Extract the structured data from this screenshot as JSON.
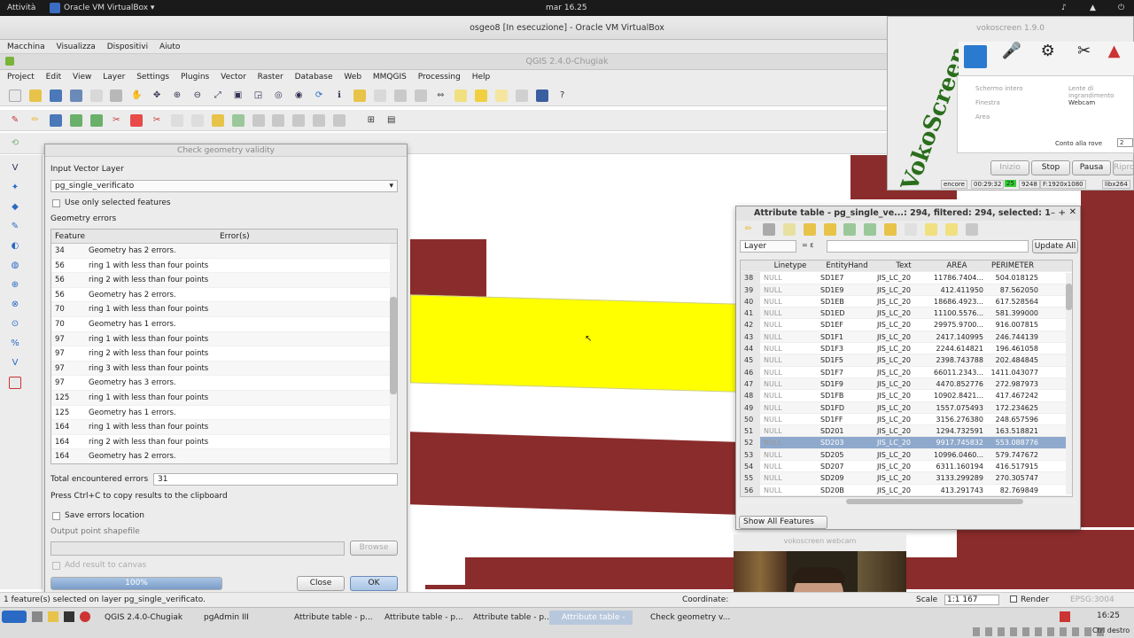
{
  "topbar": {
    "activities": "Attività",
    "vbox_app": "Oracle VM VirtualBox ▾",
    "clock": "mar 16.25"
  },
  "vbox": {
    "title": "osgeo8 [In esecuzione] - Oracle VM VirtualBox",
    "menu": [
      "Macchina",
      "Visualizza",
      "Dispositivi",
      "Aiuto"
    ]
  },
  "qgis": {
    "title": "QGIS 2.4.0-Chugiak",
    "menu": [
      "Project",
      "Edit",
      "View",
      "Layer",
      "Settings",
      "Plugins",
      "Vector",
      "Raster",
      "Database",
      "Web",
      "MMQGIS",
      "Processing",
      "Help"
    ]
  },
  "check_dialog": {
    "title": "Check geometry validity",
    "input_label": "Input Vector Layer",
    "input_value": "pg_single_verificato",
    "use_selected": "Use only selected features",
    "errors_label": "Geometry errors",
    "col_feature": "Feature",
    "col_error": "Error(s)",
    "rows": [
      {
        "f": "34",
        "e": "Geometry has 2 errors."
      },
      {
        "f": "56",
        "e": "ring 1 with less than four points"
      },
      {
        "f": "56",
        "e": "ring 2 with less than four points"
      },
      {
        "f": "56",
        "e": "Geometry has 2 errors."
      },
      {
        "f": "70",
        "e": "ring 1 with less than four points"
      },
      {
        "f": "70",
        "e": "Geometry has 1 errors."
      },
      {
        "f": "97",
        "e": "ring 1 with less than four points"
      },
      {
        "f": "97",
        "e": "ring 2 with less than four points"
      },
      {
        "f": "97",
        "e": "ring 3 with less than four points"
      },
      {
        "f": "97",
        "e": "Geometry has 3 errors."
      },
      {
        "f": "125",
        "e": "ring 1 with less than four points"
      },
      {
        "f": "125",
        "e": "Geometry has 1 errors."
      },
      {
        "f": "164",
        "e": "ring 1 with less than four points"
      },
      {
        "f": "164",
        "e": "ring 2 with less than four points"
      },
      {
        "f": "164",
        "e": "Geometry has 2 errors."
      }
    ],
    "total_label": "Total encountered errors",
    "total_value": "31",
    "copy_hint": "Press Ctrl+C to copy results to the clipboard",
    "save_errors": "Save errors location",
    "output_label": "Output point shapefile",
    "browse": "Browse",
    "add_result": "Add result to canvas",
    "progress_text": "100%",
    "progress": 1.0,
    "close": "Close",
    "ok": "OK"
  },
  "attr_table": {
    "title": "Attribute table - pg_single_ve...: 294, filtered: 294, selected: 1",
    "layer_combo": "Layer",
    "update_all": "Update All",
    "columns": [
      "Linetype",
      "EntityHand",
      "Text",
      "AREA",
      "PERIMETER"
    ],
    "rows": [
      {
        "n": "38",
        "a": "NULL",
        "b": "SD1E7",
        "c": "JIS_LC_20",
        "d": "11786.7404...",
        "e": "504.018125"
      },
      {
        "n": "39",
        "a": "NULL",
        "b": "SD1E9",
        "c": "JIS_LC_20",
        "d": "412.411950",
        "e": "87.562050"
      },
      {
        "n": "40",
        "a": "NULL",
        "b": "SD1EB",
        "c": "JIS_LC_20",
        "d": "18686.4923...",
        "e": "617.528564"
      },
      {
        "n": "41",
        "a": "NULL",
        "b": "SD1ED",
        "c": "JIS_LC_20",
        "d": "11100.5576...",
        "e": "581.399000"
      },
      {
        "n": "42",
        "a": "NULL",
        "b": "SD1EF",
        "c": "JIS_LC_20",
        "d": "29975.9700...",
        "e": "916.007815"
      },
      {
        "n": "43",
        "a": "NULL",
        "b": "SD1F1",
        "c": "JIS_LC_20",
        "d": "2417.140995",
        "e": "246.744139"
      },
      {
        "n": "44",
        "a": "NULL",
        "b": "SD1F3",
        "c": "JIS_LC_20",
        "d": "2244.614821",
        "e": "196.461058"
      },
      {
        "n": "45",
        "a": "NULL",
        "b": "SD1F5",
        "c": "JIS_LC_20",
        "d": "2398.743788",
        "e": "202.484845"
      },
      {
        "n": "46",
        "a": "NULL",
        "b": "SD1F7",
        "c": "JIS_LC_20",
        "d": "66011.2343...",
        "e": "1411.043077"
      },
      {
        "n": "47",
        "a": "NULL",
        "b": "SD1F9",
        "c": "JIS_LC_20",
        "d": "4470.852776",
        "e": "272.987973"
      },
      {
        "n": "48",
        "a": "NULL",
        "b": "SD1FB",
        "c": "JIS_LC_20",
        "d": "10902.8421...",
        "e": "417.467242"
      },
      {
        "n": "49",
        "a": "NULL",
        "b": "SD1FD",
        "c": "JIS_LC_20",
        "d": "1557.075493",
        "e": "172.234625"
      },
      {
        "n": "50",
        "a": "NULL",
        "b": "SD1FF",
        "c": "JIS_LC_20",
        "d": "3156.276380",
        "e": "248.657596"
      },
      {
        "n": "51",
        "a": "NULL",
        "b": "SD201",
        "c": "JIS_LC_20",
        "d": "1294.732591",
        "e": "163.518821"
      },
      {
        "n": "52",
        "a": "NULL",
        "b": "SD203",
        "c": "JIS_LC_20",
        "d": "9917.745832",
        "e": "553.088776"
      },
      {
        "n": "53",
        "a": "NULL",
        "b": "SD205",
        "c": "JIS_LC_20",
        "d": "10996.0460...",
        "e": "579.747672"
      },
      {
        "n": "54",
        "a": "NULL",
        "b": "SD207",
        "c": "JIS_LC_20",
        "d": "6311.160194",
        "e": "416.517915"
      },
      {
        "n": "55",
        "a": "NULL",
        "b": "SD209",
        "c": "JIS_LC_20",
        "d": "3133.299289",
        "e": "270.305747"
      },
      {
        "n": "56",
        "a": "NULL",
        "b": "SD20B",
        "c": "JIS_LC_20",
        "d": "413.291743",
        "e": "82.769849"
      }
    ],
    "show_all": "Show All Features"
  },
  "vokoscreen": {
    "title": "vokoscreen 1.9.0",
    "logo": "VokoScreen",
    "opt1": "Schermo intero",
    "opt2": "Finestra",
    "opt3": "Area",
    "chk1": "Lente di ingrandimento",
    "chk2": "Webcam",
    "countdown_label": "Conto alla rove",
    "countdown_value": "2",
    "start": "Inizio",
    "stop": "Stop",
    "pause": "Pausa",
    "play": "Riprodu",
    "stat1": "encore",
    "stat2": "00:29:32",
    "stat3": "25",
    "stat4": "9248",
    "stat5": "F:1920x1080",
    "stat6": "libx264"
  },
  "webcam": {
    "title": "vokoscreen webcam"
  },
  "statusbar": {
    "message": "1 feature(s) selected on layer pg_single_verificato.",
    "coord_label": "Coordinate:",
    "scale_label": "Scale",
    "scale_value": "1:1 167",
    "render": "Render",
    "epsg": "EPSG:3004"
  },
  "taskbar": {
    "items": [
      "QGIS 2.4.0-Chugiak",
      "pgAdmin III",
      "Attribute table - p...",
      "Attribute table - p...",
      "Attribute table - p...",
      "Attribute table - p...",
      "Check geometry v..."
    ],
    "clock": "16:25",
    "key": "Ctrl destro"
  }
}
